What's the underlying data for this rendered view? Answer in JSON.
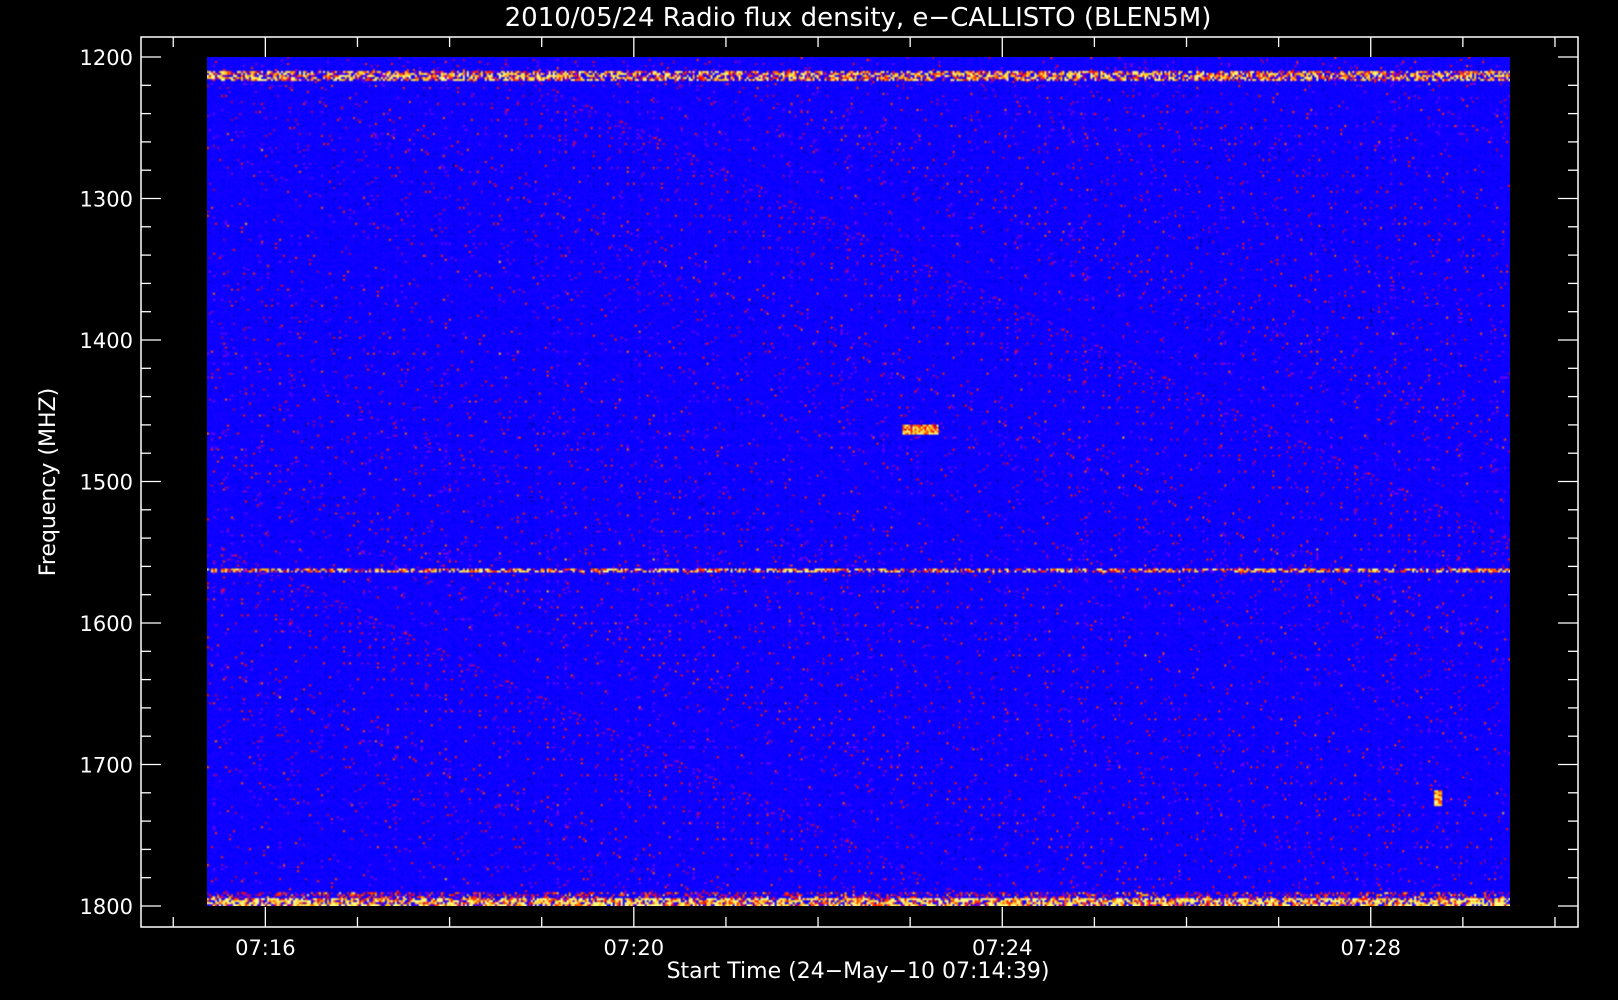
{
  "chart_data": {
    "type": "heatmap",
    "title": "2010/05/24  Radio flux density, e−CALLISTO (BLEN5M)",
    "xlabel": "Start Time (24−May−10 07:14:39)",
    "ylabel": "Frequency (MHZ)",
    "x_range": [
      "07:14:39",
      "07:29:59"
    ],
    "xlim": [
      "07:14:39",
      "07:30:15"
    ],
    "ylim": [
      1800,
      1200
    ],
    "y_axis_inverted": true,
    "x_ticks": [
      "07:16",
      "07:20",
      "07:24",
      "07:28"
    ],
    "y_ticks": [
      1200,
      1300,
      1400,
      1500,
      1600,
      1700,
      1800
    ],
    "colormap": [
      "#000000",
      "#0000ff",
      "#8b0000",
      "#ff2000",
      "#ff9000",
      "#ffff80"
    ],
    "features": [
      {
        "type": "band",
        "frequency_range": [
          1210,
          1215
        ],
        "description": "strong intermittent interference"
      },
      {
        "type": "band",
        "frequency_range": [
          1561,
          1563
        ],
        "description": "narrow interference line"
      },
      {
        "type": "band",
        "frequency_range": [
          1795,
          1800
        ],
        "description": "bottom-edge emission"
      },
      {
        "type": "patch",
        "time_range": [
          "07:22:50",
          "07:23:15"
        ],
        "frequency_range": [
          1460,
          1466
        ]
      },
      {
        "type": "patch",
        "time_range": [
          "07:29:05",
          "07:29:10"
        ],
        "frequency_range": [
          1718,
          1728
        ]
      }
    ],
    "grid": false,
    "background": "#000000",
    "axis_color": "#ffffff"
  }
}
